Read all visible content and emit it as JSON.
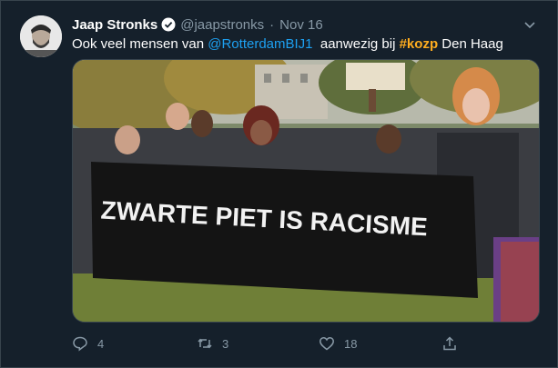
{
  "tweet": {
    "display_name": "Jaap Stronks",
    "handle": "@jaapstronks",
    "separator": "·",
    "time": "Nov 16",
    "text_prefix": "Ook veel mensen van ",
    "mention": "@RotterdamBIJ1",
    "text_middle": "  aanwezig bij ",
    "hashtag": "#kozp",
    "text_suffix": " Den Haag",
    "banner_text": "ZWARTE PIET IS RACISME"
  },
  "actions": {
    "reply_count": "4",
    "retweet_count": "3",
    "like_count": "18"
  },
  "icons": {
    "verified": "verified-badge-icon",
    "caret": "chevron-down-icon",
    "reply": "reply-icon",
    "retweet": "retweet-icon",
    "like": "heart-icon",
    "share": "share-icon"
  },
  "colors": {
    "background": "#15202b",
    "link": "#1da1f2",
    "hashtag": "#ffad1f",
    "muted": "#8899a6"
  }
}
